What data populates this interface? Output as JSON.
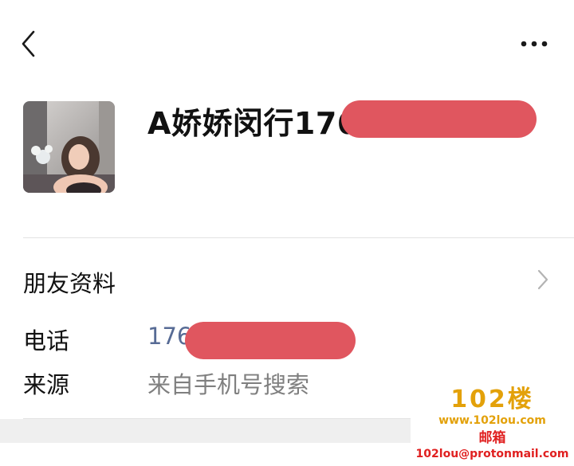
{
  "header": {
    "back_icon": "chevron-left-icon",
    "more_icon": "more-horizontal-icon"
  },
  "profile": {
    "name": "A娇娇闵行176",
    "avatar": "profile-photo",
    "redaction_color": "#e0565f"
  },
  "friend_info": {
    "label": "朋友资料",
    "chevron_icon": "chevron-right-icon"
  },
  "phone": {
    "label": "电话",
    "value": "176",
    "value_color": "#576b95"
  },
  "source": {
    "label": "来源",
    "value": "来自手机号搜索",
    "value_color": "#7f7f7f"
  },
  "watermark": {
    "logo": "102楼",
    "url": "www.102lou.com",
    "mail_label": "邮箱",
    "mail": "102lou@protonmail.com"
  }
}
